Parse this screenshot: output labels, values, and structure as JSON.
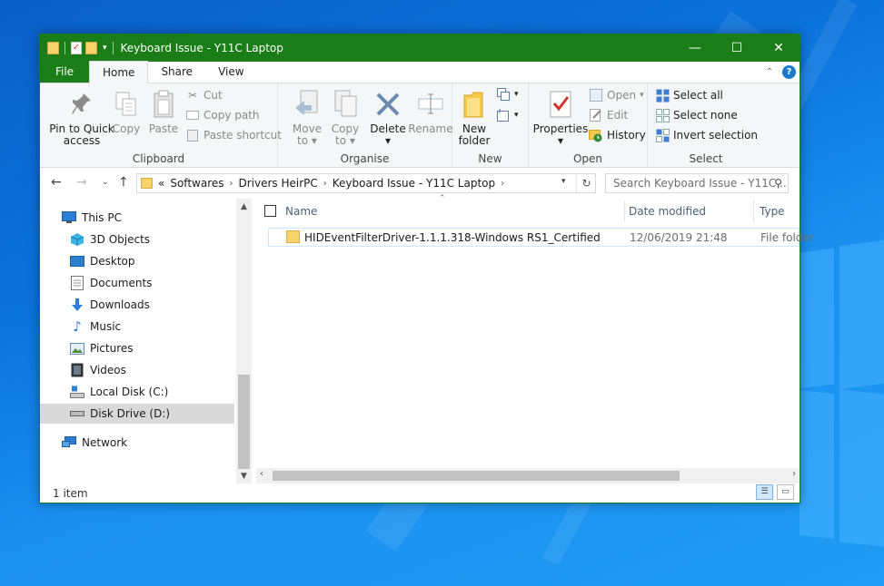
{
  "window": {
    "title": "Keyboard Issue - Y11C Laptop",
    "minimize": "—",
    "maximize": "☐",
    "close": "✕"
  },
  "ribbon_tabs": [
    "File",
    "Home",
    "Share",
    "View"
  ],
  "ribbon": {
    "clipboard": {
      "label": "Clipboard",
      "pin_line1": "Pin to Quick",
      "pin_line2": "access",
      "copy": "Copy",
      "paste": "Paste",
      "cut": "Cut",
      "copy_path": "Copy path",
      "paste_shortcut": "Paste shortcut"
    },
    "organise": {
      "label": "Organise",
      "move_line1": "Move",
      "move_line2": "to",
      "copy_line1": "Copy",
      "copy_line2": "to",
      "delete": "Delete",
      "rename": "Rename"
    },
    "new": {
      "label": "New",
      "line1": "New",
      "line2": "folder"
    },
    "open": {
      "label": "Open",
      "properties": "Properties",
      "open": "Open",
      "edit": "Edit",
      "history": "History"
    },
    "select": {
      "label": "Select",
      "select_all": "Select all",
      "select_none": "Select none",
      "invert": "Invert selection"
    }
  },
  "address": {
    "prefix": "«",
    "crumbs": [
      "Softwares",
      "Drivers HeirPC",
      "Keyboard Issue - Y11C Laptop"
    ],
    "search_placeholder": "Search Keyboard Issue - Y11C ..."
  },
  "nav": {
    "items": [
      {
        "label": "This PC",
        "icon": "this-pc-icon"
      },
      {
        "label": "3D Objects",
        "icon": "3d-objects-icon"
      },
      {
        "label": "Desktop",
        "icon": "desktop-icon"
      },
      {
        "label": "Documents",
        "icon": "documents-icon"
      },
      {
        "label": "Downloads",
        "icon": "downloads-icon"
      },
      {
        "label": "Music",
        "icon": "music-icon"
      },
      {
        "label": "Pictures",
        "icon": "pictures-icon"
      },
      {
        "label": "Videos",
        "icon": "videos-icon"
      },
      {
        "label": "Local Disk (C:)",
        "icon": "local-disk-icon"
      },
      {
        "label": "Disk Drive (D:)",
        "icon": "disk-drive-icon"
      },
      {
        "label": "Network",
        "icon": "network-icon"
      }
    ],
    "selected": "Disk Drive (D:)"
  },
  "files": {
    "columns": [
      "Name",
      "Date modified",
      "Type"
    ],
    "rows": [
      {
        "name": "HIDEventFilterDriver-1.1.1.318-Windows RS1_Certified",
        "date": "12/06/2019 21:48",
        "type": "File folder"
      }
    ]
  },
  "status": {
    "count": "1 item"
  },
  "colors": {
    "titlebar": "#1b7d17",
    "accent_blue": "#1979ca",
    "folder_yellow": "#f7d36b"
  }
}
